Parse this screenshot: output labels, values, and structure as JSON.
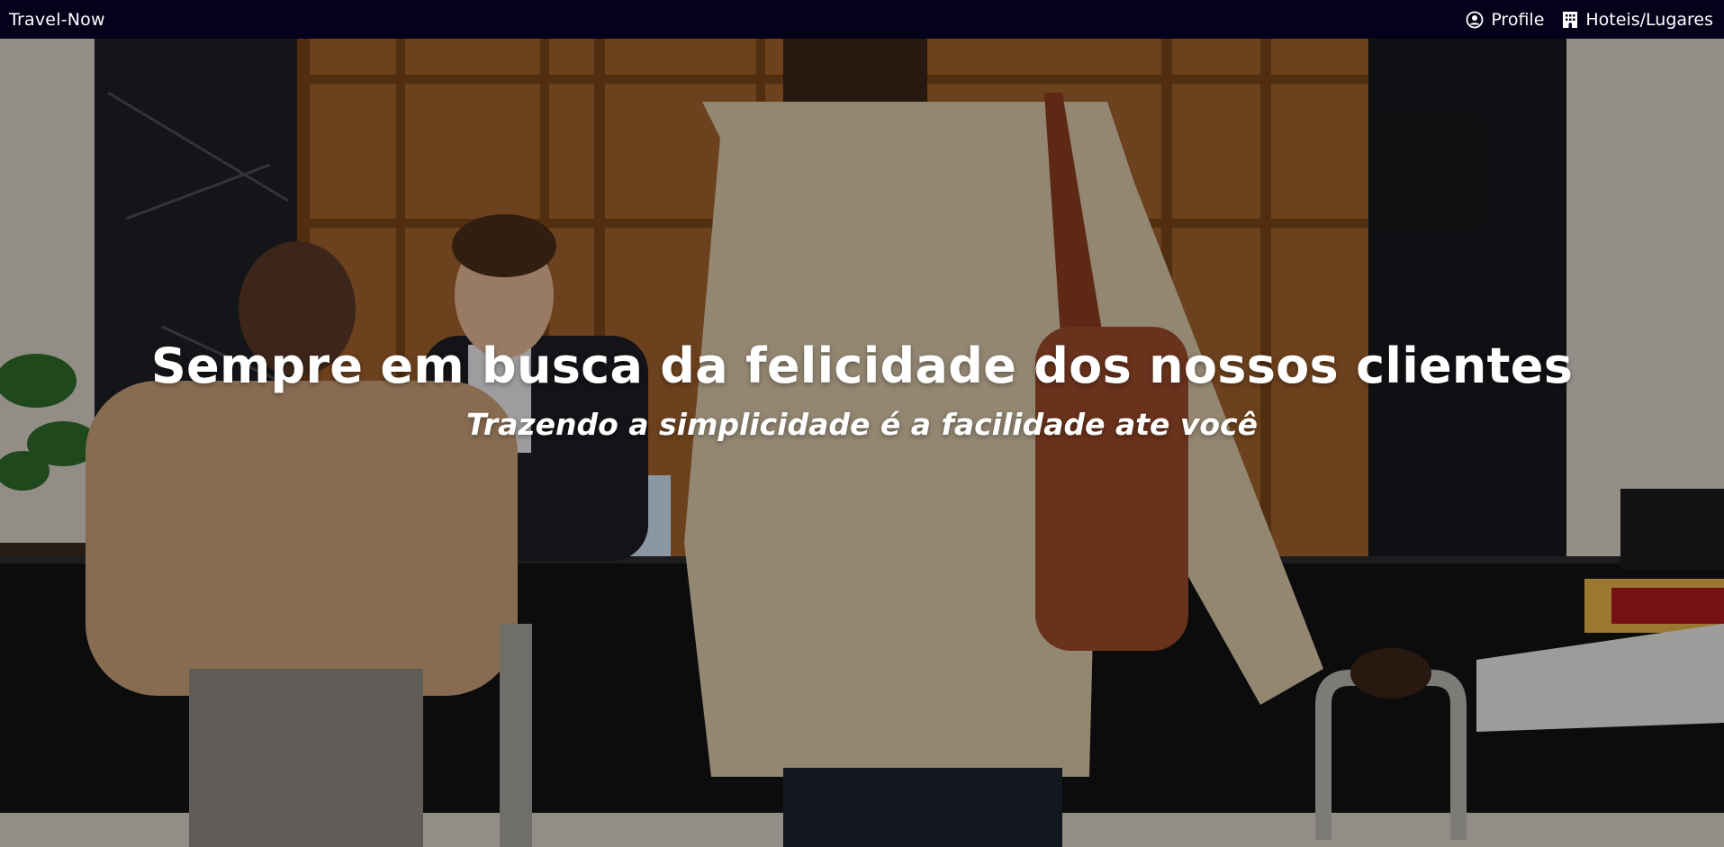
{
  "navbar": {
    "brand": "Travel-Now",
    "links": [
      {
        "label": "Profile",
        "icon": "user-circle-icon"
      },
      {
        "label": "Hoteis/Lugares",
        "icon": "building-icon"
      }
    ]
  },
  "hero": {
    "title": "Sempre em busca da felicidade dos nossos clientes",
    "subtitle": "Trazendo a simplicidade é a facilidade ate você",
    "image": "hotel-lobby-background"
  },
  "colors": {
    "navbar_bg": "#04021a",
    "text": "#ffffff"
  }
}
